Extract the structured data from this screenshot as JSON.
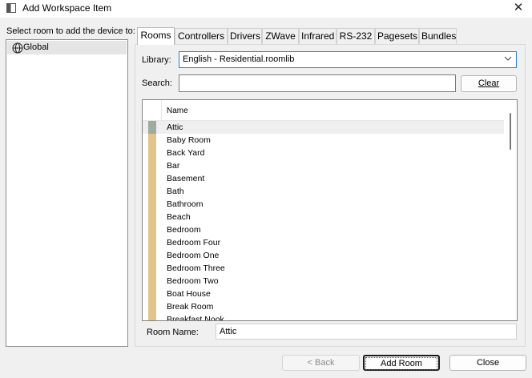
{
  "window": {
    "title": "Add Workspace Item",
    "close_glyph": "✕"
  },
  "left": {
    "label": "Select room to add the device to:",
    "tree_items": [
      {
        "label": "Global",
        "icon": "globe-icon"
      }
    ]
  },
  "tabs": [
    {
      "label": "Rooms",
      "active": true
    },
    {
      "label": "Controllers"
    },
    {
      "label": "Drivers"
    },
    {
      "label": "ZWave"
    },
    {
      "label": "Infrared"
    },
    {
      "label": "RS-232"
    },
    {
      "label": "Pagesets"
    },
    {
      "label": "Bundles"
    }
  ],
  "form": {
    "library_label": "Library:",
    "library_value": "English - Residential.roomlib",
    "search_label": "Search:",
    "search_value": "",
    "clear_button": "Clear",
    "room_name_label": "Room Name:",
    "room_name_value": "Attic"
  },
  "list": {
    "column_header": "Name",
    "selected_index": 0,
    "rows": [
      "Attic",
      "Baby Room",
      "Back Yard",
      "Bar",
      "Basement",
      "Bath",
      "Bathroom",
      "Beach",
      "Bedroom",
      "Bedroom Four",
      "Bedroom One",
      "Bedroom Three",
      "Bedroom Two",
      "Boat House",
      "Break Room",
      "Breakfast Nook"
    ]
  },
  "buttons": {
    "back": "< Back",
    "add_room": "Add Room",
    "close": "Close"
  },
  "colors": {
    "folder_marker": "#e0c489",
    "selected_marker": "#9eab9e",
    "focus_border": "#2c7fd1"
  }
}
